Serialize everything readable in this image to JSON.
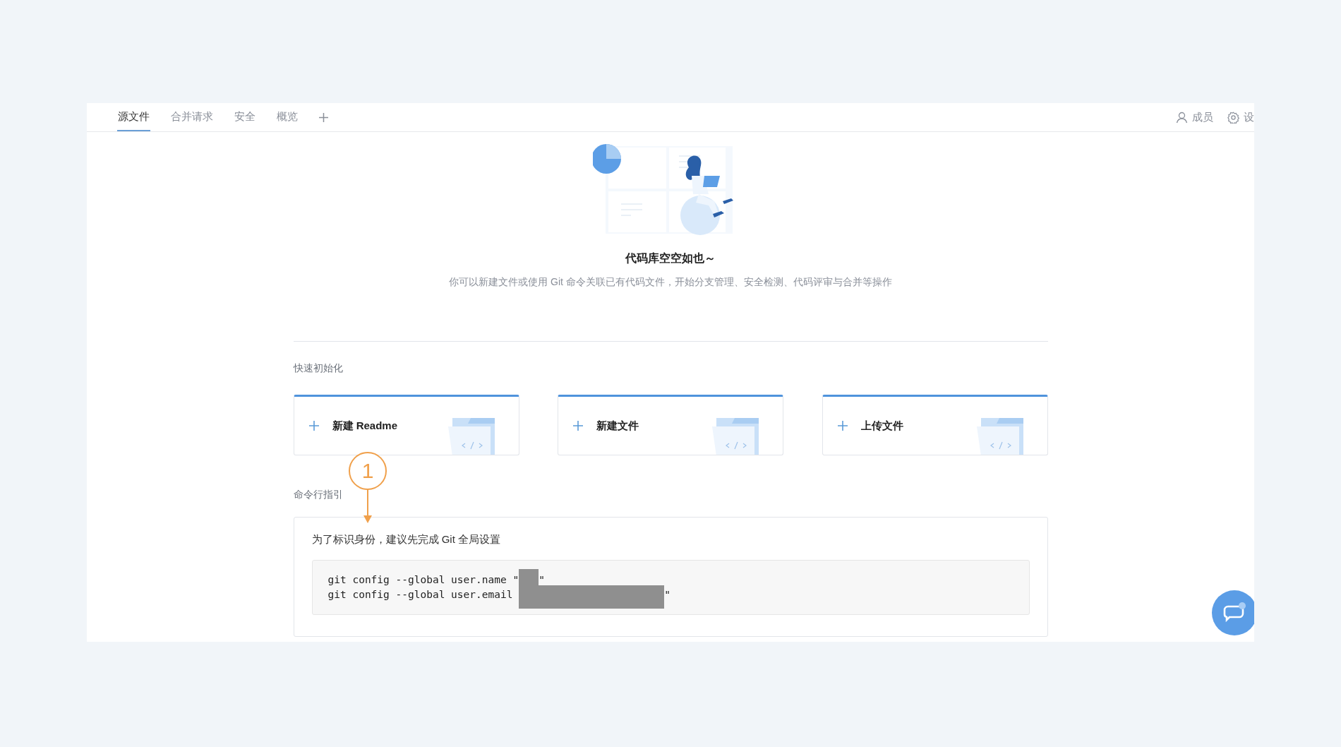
{
  "tabs": [
    {
      "label": "源文件",
      "selected": true
    },
    {
      "label": "合并请求",
      "selected": false
    },
    {
      "label": "安全",
      "selected": false
    },
    {
      "label": "概览",
      "selected": false
    }
  ],
  "header_actions": [
    {
      "kind": "members",
      "label": "成员"
    },
    {
      "kind": "settings",
      "label": "设"
    }
  ],
  "empty_state": {
    "title": "代码库空空如也～",
    "description": "你可以新建文件或使用 Git 命令关联已有代码文件，开始分支管理、安全检测、代码评审与合并等操作"
  },
  "quick_init": {
    "heading": "快速初始化",
    "cards": [
      {
        "label": "新建 Readme"
      },
      {
        "label": "新建文件"
      },
      {
        "label": "上传文件"
      }
    ]
  },
  "guide": {
    "heading": "命令行指引",
    "intro": "为了标识身份，建议先完成 Git 全局设置",
    "code_lines": [
      {
        "prefix": "git config --global user.name \"",
        "suffix": "\"",
        "redacted": true
      },
      {
        "prefix": "git config --global user.email ",
        "suffix": "\"",
        "redacted": true
      }
    ]
  },
  "annotation": {
    "number": "1"
  }
}
